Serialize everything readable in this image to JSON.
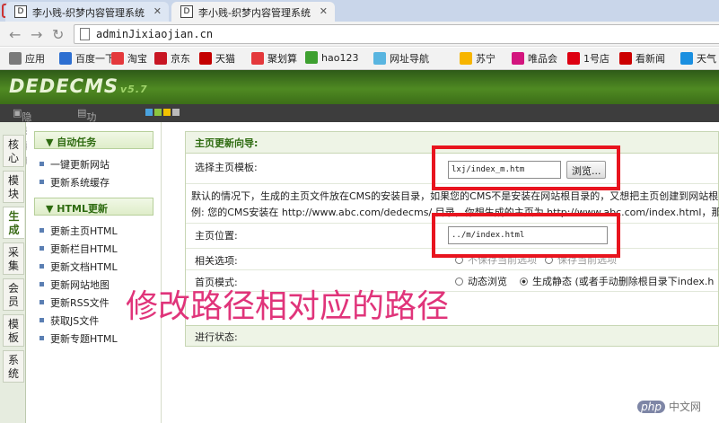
{
  "browser": {
    "tabs": [
      {
        "title": "李小贱-织梦内容管理系统"
      },
      {
        "title": "李小贱-织梦内容管理系统"
      }
    ],
    "url": "adminJixiaojian.cn",
    "bookmarks": [
      {
        "label": "应用",
        "color": "#7a7a7a"
      },
      {
        "label": "百度一下",
        "color": "#2d6fd1"
      },
      {
        "label": "淘宝",
        "color": "#e4393c"
      },
      {
        "label": "京东",
        "color": "#c81623"
      },
      {
        "label": "天猫",
        "color": "#c40000"
      },
      {
        "label": "聚划算",
        "color": "#e4393c"
      },
      {
        "label": "hao123",
        "color": "#3ea030"
      },
      {
        "label": "网址导航",
        "color": "#59b5e0"
      },
      {
        "label": "苏宁",
        "color": "#f7b500"
      },
      {
        "label": "唯品会",
        "color": "#d3157e"
      },
      {
        "label": "1号店",
        "color": "#d01"
      },
      {
        "label": "看新闻",
        "color": "#c00"
      },
      {
        "label": "天气",
        "color": "#1a8fe0"
      }
    ]
  },
  "cms": {
    "logo_text": "DEDECMS",
    "logo_version": "v5.7",
    "subbar": {
      "hide_menu": "隐藏菜单",
      "site_map": "功能地图"
    },
    "vertical_tabs": [
      "核心",
      "模块",
      "生成",
      "采集",
      "会员",
      "模板",
      "系统"
    ],
    "active_tab": "生成",
    "menu": {
      "section1_title": "自动任务",
      "section1_items": [
        "一键更新网站",
        "更新系统缓存"
      ],
      "section2_title": "HTML更新",
      "section2_items": [
        "更新主页HTML",
        "更新栏目HTML",
        "更新文档HTML",
        "更新网站地图",
        "更新RSS文件",
        "获取JS文件",
        "更新专题HTML"
      ]
    },
    "panel": {
      "title": "主页更新向导:",
      "template_label": "选择主页模板:",
      "template_value": "lxj/index_m.htm",
      "browse_button": "浏览...",
      "info_text_1": "默认的情况下，生成的主页文件放在CMS的安装目录，如果您的CMS不是安装在网站根目录的，又想把主页创建到网站根目录",
      "info_text_2": "例: 您的CMS安装在 http://www.abc.com/dedecms/ 目录，你想生成的主页为 http://www.abc.com/index.html，那么主页",
      "position_label": "主页位置:",
      "position_value": "../m/index.html",
      "options_label": "相关选项:",
      "option_1": "不保存当前选项",
      "option_2": "保存当前选项",
      "mode_label": "首页模式:",
      "mode_1": "动态浏览",
      "mode_2": "生成静态",
      "mode_note": "(或者手动删除根目录下index.h",
      "status_label": "进行状态:"
    },
    "annotation": "修改路径相对应的路径",
    "watermark": "中文网"
  },
  "colors": {
    "highlight": "#e8141e",
    "annotation": "#e0347a",
    "brand_green": "#4f8a22"
  }
}
